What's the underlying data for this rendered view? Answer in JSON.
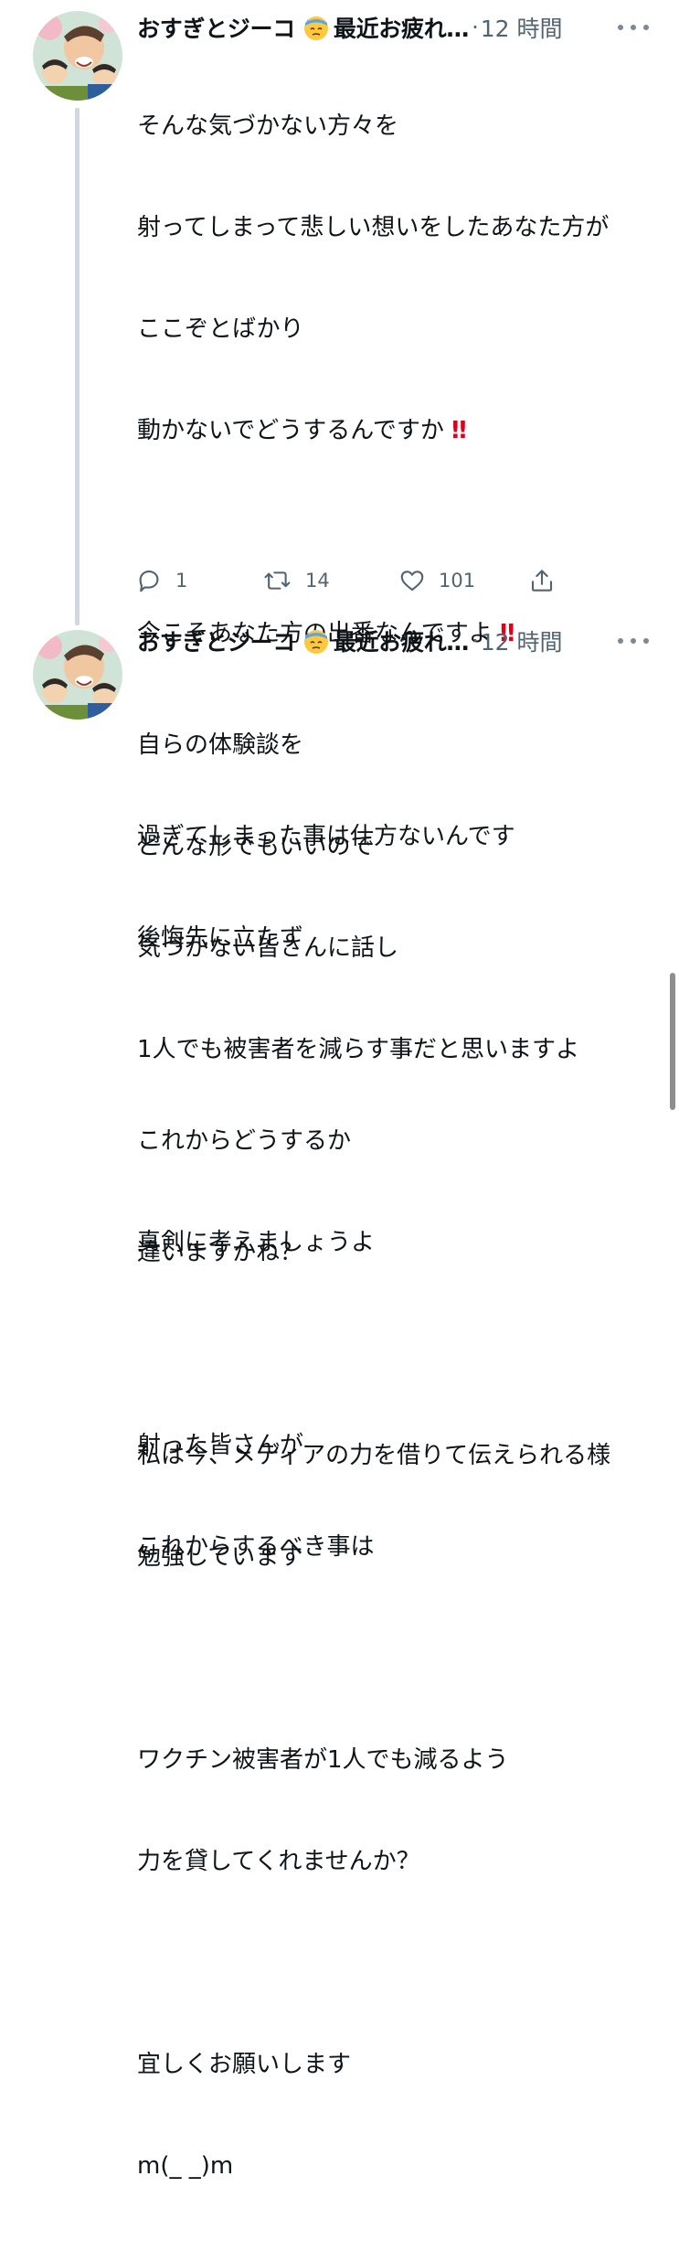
{
  "tweets": [
    {
      "display_name": "おすぎとジーコ",
      "status_emoji": "downcast-sweat-face-emoji",
      "status": "最近お疲れ…",
      "separator": "·",
      "time": "12 時間",
      "lines": [
        "そんな気づかない方々を",
        "射ってしまって悲しい想いをしたあなた方が",
        "ここぞとばかり",
        "動かないでどうするんですか",
        "",
        "今こそあなた方の出番なんですよ",
        "",
        "過ぎてしまった事は仕方ないんです",
        "後悔先に立たず",
        "",
        "これからどうするか",
        "真剣に考えましょうよ",
        "",
        "射った皆さんが",
        "これからするべき事は"
      ],
      "exclaim": "‼",
      "actions": {
        "reply_count": "1",
        "retweet_count": "14",
        "like_count": "101"
      }
    },
    {
      "display_name": "おすぎとジーコ",
      "status_emoji": "downcast-sweat-face-emoji",
      "status": "最近お疲れ…",
      "separator": "·",
      "time": "12 時間",
      "lines": [
        "自らの体験談を",
        "どんな形でもいいので",
        "気づかない皆さんに話し",
        "1人でも被害者を減らす事だと思いますよ",
        "",
        "違いますかね？",
        "",
        "私は今、メディアの力を借りて伝えられる様",
        "勉強しています",
        "",
        "ワクチン被害者が1人でも減るよう",
        "力を貸してくれませんか？",
        "",
        "宜しくお願いします",
        "m(_ _)m"
      ]
    }
  ],
  "colors": {
    "text": "#0f1419",
    "secondary": "#536471",
    "thread_line": "#cfd9de",
    "exclaim": "#e0001b"
  },
  "icons": [
    "reply-icon",
    "retweet-icon",
    "like-icon",
    "share-icon",
    "more-options-icon"
  ]
}
